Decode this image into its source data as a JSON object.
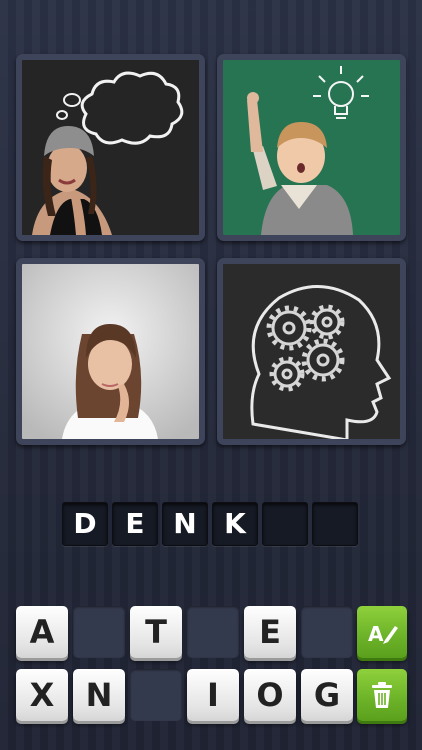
{
  "images": [
    {
      "name": "thinking-woman-chalkboard"
    },
    {
      "name": "boy-lightbulb-idea"
    },
    {
      "name": "thoughtful-woman-grey"
    },
    {
      "name": "head-gears-chalk"
    }
  ],
  "answer": {
    "letters": [
      "D",
      "E",
      "N",
      "K",
      "",
      ""
    ]
  },
  "keyboard": {
    "row1": [
      "A",
      "",
      "T",
      "",
      "E",
      ""
    ],
    "row2": [
      "X",
      "N",
      "",
      "I",
      "O",
      "G"
    ]
  },
  "buttons": {
    "hint_icon": "letter-hint-icon",
    "remove_icon": "trash-icon",
    "hint_color": "#74bb2c"
  }
}
